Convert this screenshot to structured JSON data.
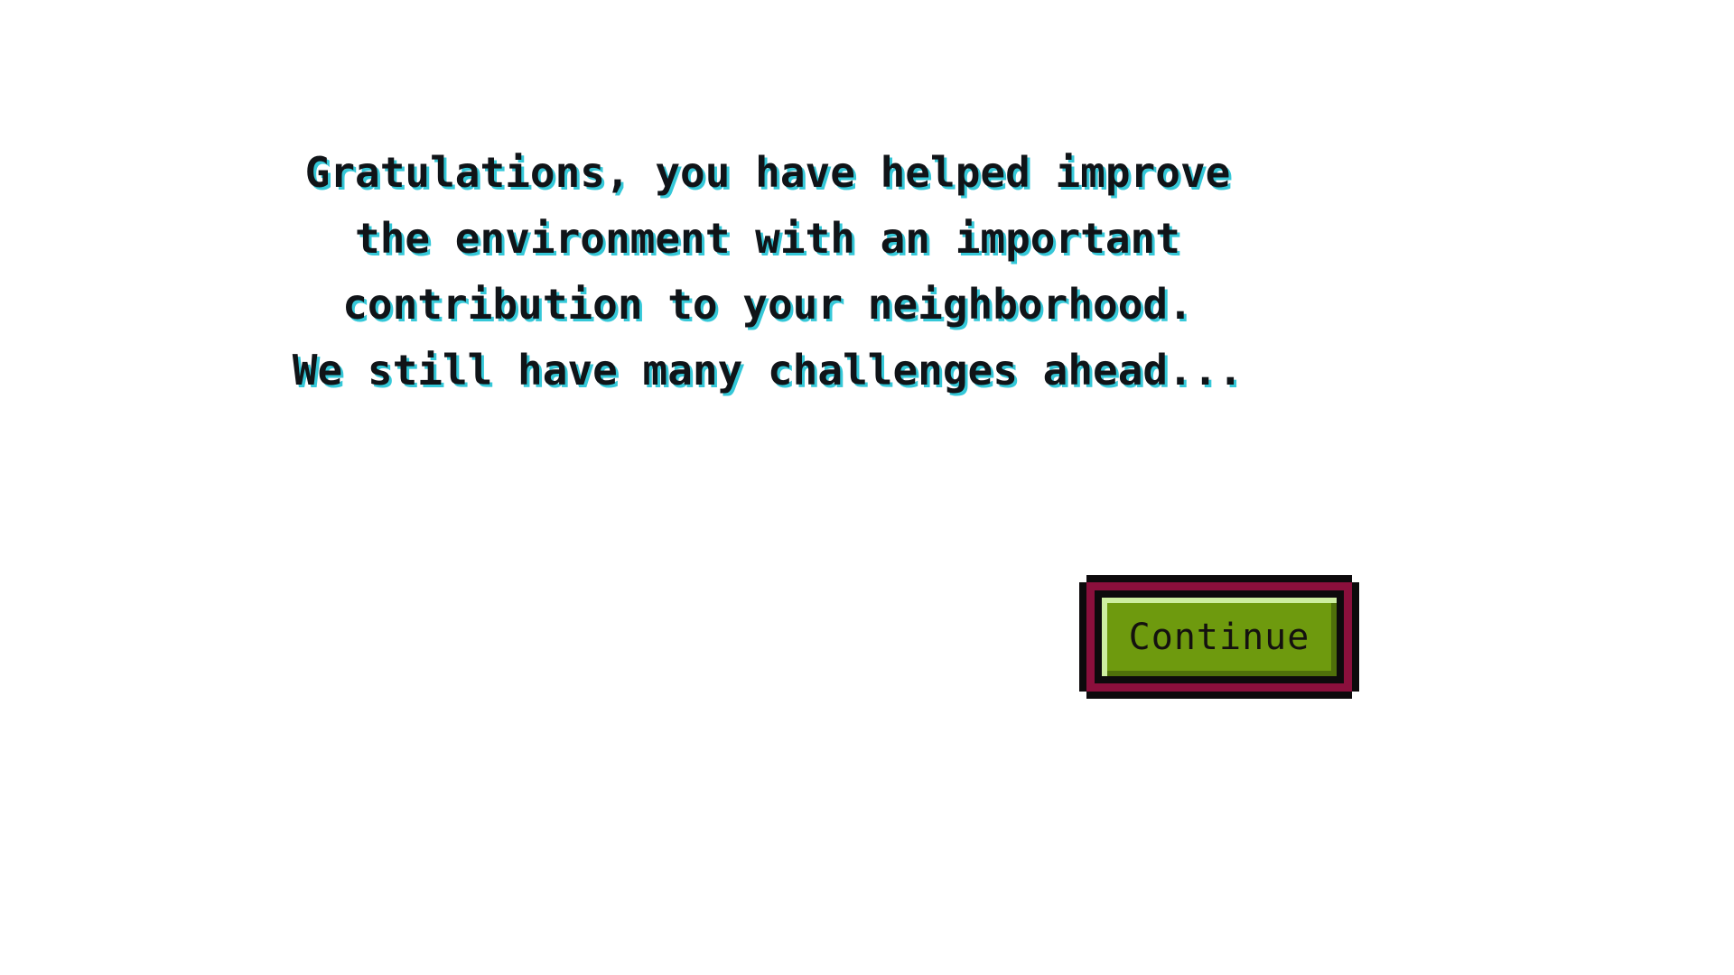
{
  "message": {
    "lines": [
      "Gratulations, you have helped improve",
      "the environment with an important",
      "contribution to your neighborhood.",
      "We still have many challenges ahead..."
    ]
  },
  "button": {
    "label": "Continue"
  },
  "colors": {
    "background": "#ffffff",
    "text": "#101418",
    "text_shadow": "#35c8d8",
    "button_outer": "#0d0a0c",
    "button_frame": "#8b0f3c",
    "button_face": "#6e9a0e",
    "button_highlight": "#cdeea0"
  }
}
